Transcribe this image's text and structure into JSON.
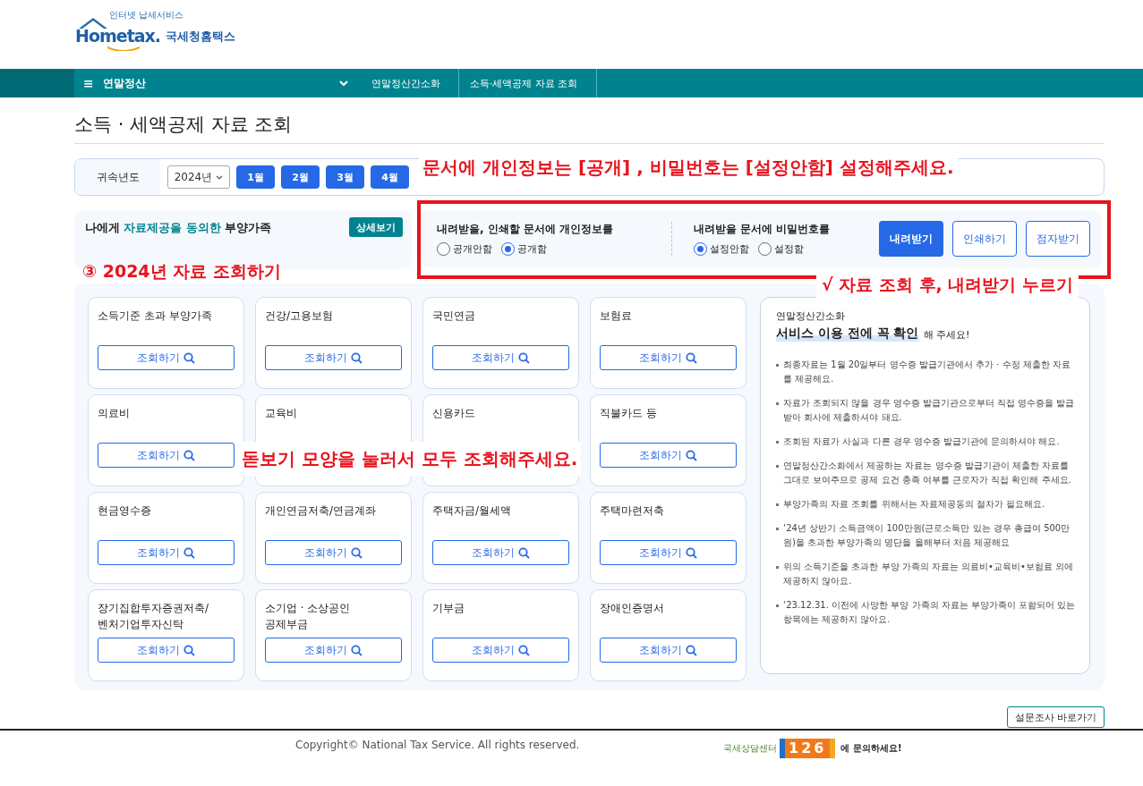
{
  "header": {
    "logo": {
      "tagline": "인터넷 납세서비스",
      "wordmark": "Hometax.",
      "name": "국세청홈택스"
    }
  },
  "nav": {
    "menu_icon": "≡",
    "menu": "연말정산",
    "breadcrumbs": [
      "연말정산간소화",
      "소득·세액공제 자료 조회"
    ]
  },
  "page_title": "소득 · 세액공제 자료 조회",
  "year_filter": {
    "label": "귀속년도",
    "year": "2024년",
    "months": [
      "1월",
      "2월",
      "3월",
      "4월"
    ]
  },
  "consent_panel": {
    "text": "나에게 **자료제공을 동의한** 부양가족",
    "button": "상세보기"
  },
  "download_options": {
    "groups": [
      {
        "label": "내려받을, 인쇄할 문서에 개인정보를",
        "options": [
          {
            "label": "공개안함",
            "selected": false
          },
          {
            "label": "공개함",
            "selected": true
          }
        ]
      },
      {
        "label": "내려받을 문서에 비밀번호를",
        "options": [
          {
            "label": "설정안함",
            "selected": true
          },
          {
            "label": "설정함",
            "selected": false
          }
        ]
      }
    ],
    "buttons": [
      {
        "label": "내려받기",
        "kind": "primary"
      },
      {
        "label": "인쇄하기",
        "kind": "outline"
      },
      {
        "label": "점자받기",
        "kind": "outline"
      }
    ]
  },
  "cards": [
    {
      "title": "소득기준 초과 부양가족",
      "button": "조회하기"
    },
    {
      "title": "건강/고용보험",
      "button": "조회하기"
    },
    {
      "title": "국민연금",
      "button": "조회하기"
    },
    {
      "title": "보험료",
      "button": "조회하기"
    },
    {
      "title": "의료비",
      "button": "조회하기"
    },
    {
      "title": "교육비"
    },
    {
      "title": "신용카드"
    },
    {
      "title": "직불카드 등",
      "button": "조회하기"
    },
    {
      "title": "현금영수증",
      "button": "조회하기"
    },
    {
      "title": "개인연금저축/연금계좌",
      "button": "조회하기"
    },
    {
      "title": "주택자금/월세액",
      "button": "조회하기"
    },
    {
      "title": "주택마련저축",
      "button": "조회하기"
    },
    {
      "title": "장기집합투자증권저축/\n벤처기업투자신탁",
      "button": "조회하기"
    },
    {
      "title": "소기업 · 소상공인\n공제부금",
      "button": "조회하기"
    },
    {
      "title": "기부금",
      "button": "조회하기"
    },
    {
      "title": "장애인증명서",
      "button": "조회하기"
    }
  ],
  "notice": {
    "label": "연말정산간소화",
    "heading": "서비스 이용 전에 꼭 확인",
    "heading_suffix": "해 주세요!",
    "items": [
      "최종자료는 1월 20일부터 영수증 발급기관에서 추가 · 수정 제출한 자료를 제공해요.",
      "자료가 조회되지 않을 경우 영수증 발급기관으로부터 직접 영수증을 발급받아 회사에 제출하셔야 돼요.",
      "조회된 자료가 사실과 다른 경우 영수증 발급기관에 문의하셔야 해요.",
      "연말정산간소화에서 제공하는 자료는 영수증 발급기관이 제출한 자료를 그대로 보여주므로 공제 요건 충족 여부를 근로자가 직접 확인해 주세요.",
      "부양가족의 자료 조회를 위해서는 자료제공동의 절차가 필요해요.",
      "‘24년 상반기 소득금액이 100만원(근로소득만 있는 경우 총급여 500만원)을 초과한 부양가족의 명단을 올해부터 처음 제공해요",
      "위의 소득기준을 초과한 부양 가족의 자료는 의료비•교육비•보험료 외에 제공하지 않아요.",
      "‘23.12.31. 이전에 사망한 부양 가족의 자료는 부양가족이 포함되어 있는 항목에는 제공하지 않아요."
    ]
  },
  "survey_button": "설문조사 바로가기",
  "footer": {
    "copyright": "Copyright© National Tax Service. All rights reserved.",
    "center_name": "국세상담센터",
    "center_number": "126",
    "center_suffix": "에 문의하세요!"
  },
  "annotations": [
    {
      "kind": "top",
      "text": "문서에 개인정보는 [공개] , 비밀번호는 [설정안함] 설정해주세요."
    },
    {
      "kind": "frame"
    },
    {
      "kind": "step",
      "text": "③ 2024년 자료 조회하기"
    },
    {
      "kind": "right",
      "text": "√ 자료 조회 후, 내려받기 누르기"
    },
    {
      "kind": "middle",
      "text": "돋보기 모양을 눌러서 모두 조회해주세요."
    }
  ]
}
